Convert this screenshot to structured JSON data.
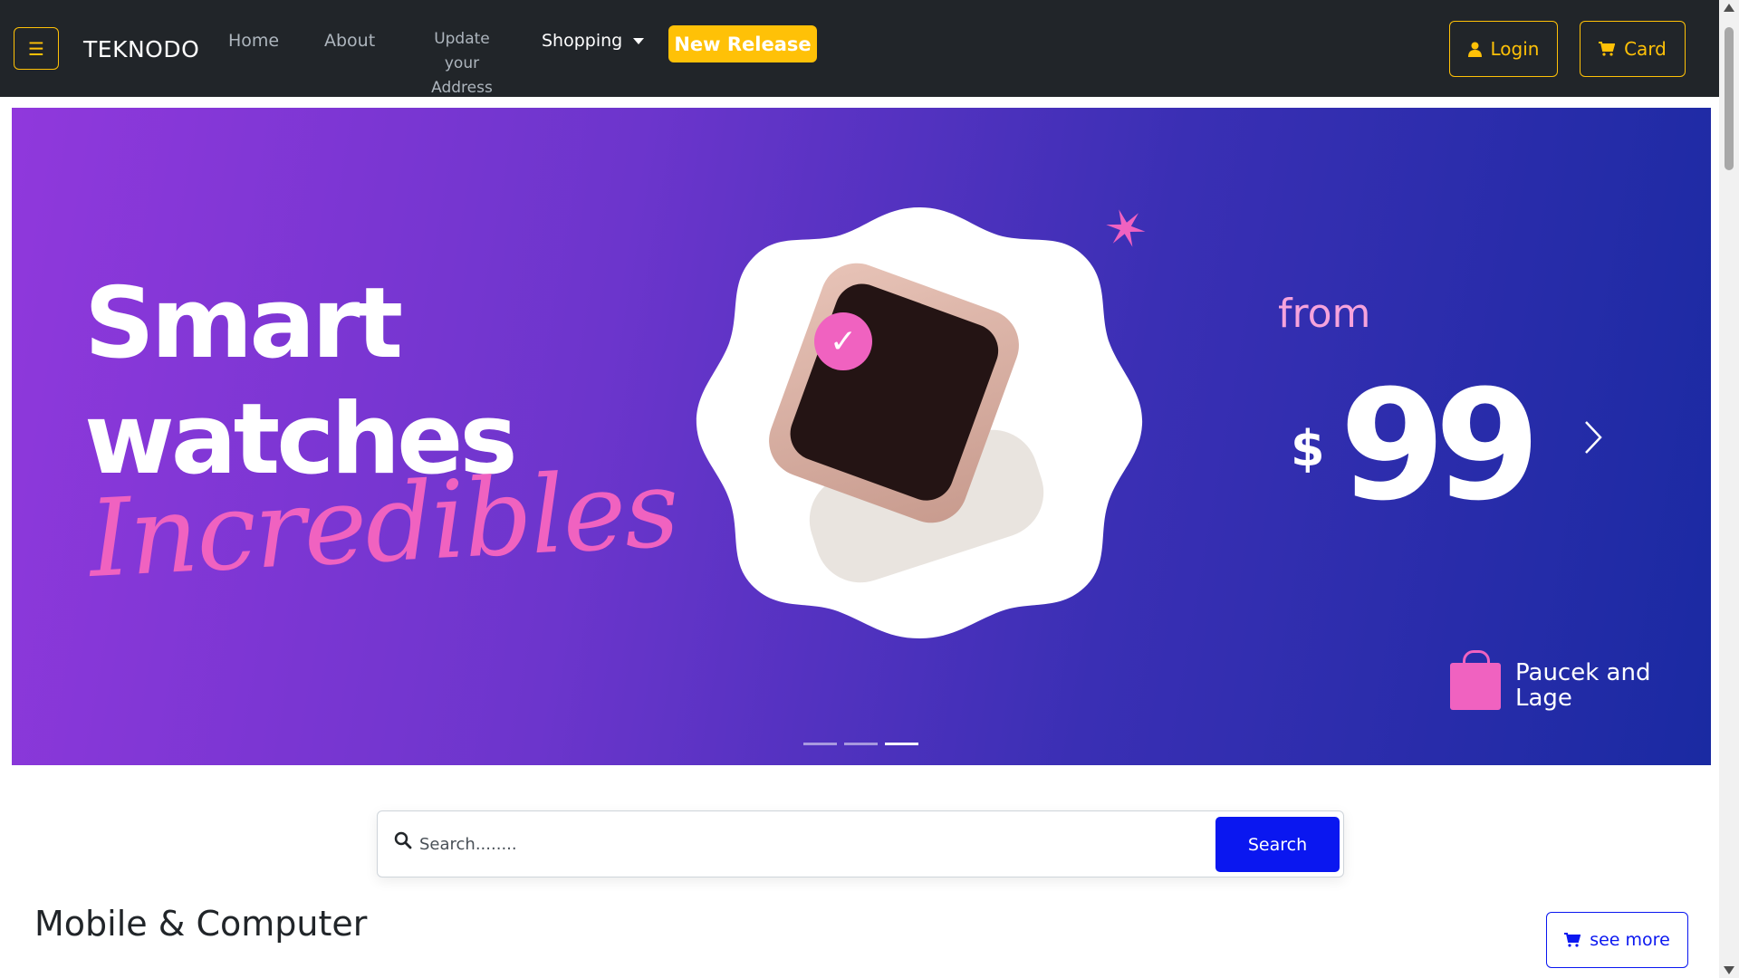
{
  "navbar": {
    "menu_icon": "hamburger-icon",
    "brand": "TEKNODO",
    "links": {
      "home": "Home",
      "about": "About",
      "address_line1": "Update your",
      "address_line2": "Address",
      "shopping": "Shopping"
    },
    "new_release": "New Release",
    "login": "Login",
    "card": "Card",
    "login_icon": "user-icon",
    "card_icon": "cart-icon",
    "accent_color": "#ffc107"
  },
  "carousel": {
    "headline_line1": "Smart",
    "headline_line2": "watches",
    "script_text": "Incredibles",
    "from_text": "from",
    "currency": "$",
    "price": "99",
    "company_line1": "Paucek and",
    "company_line2": "Lage",
    "next_icon": "chevron-right-icon",
    "slide_count": 3,
    "active_slide": 3
  },
  "search": {
    "icon": "search-icon",
    "placeholder": "Search........",
    "button": "Search",
    "button_color": "#0a17f0"
  },
  "section": {
    "title": "Mobile & Computer",
    "see_more": "see more",
    "see_more_icon": "cart-icon"
  }
}
